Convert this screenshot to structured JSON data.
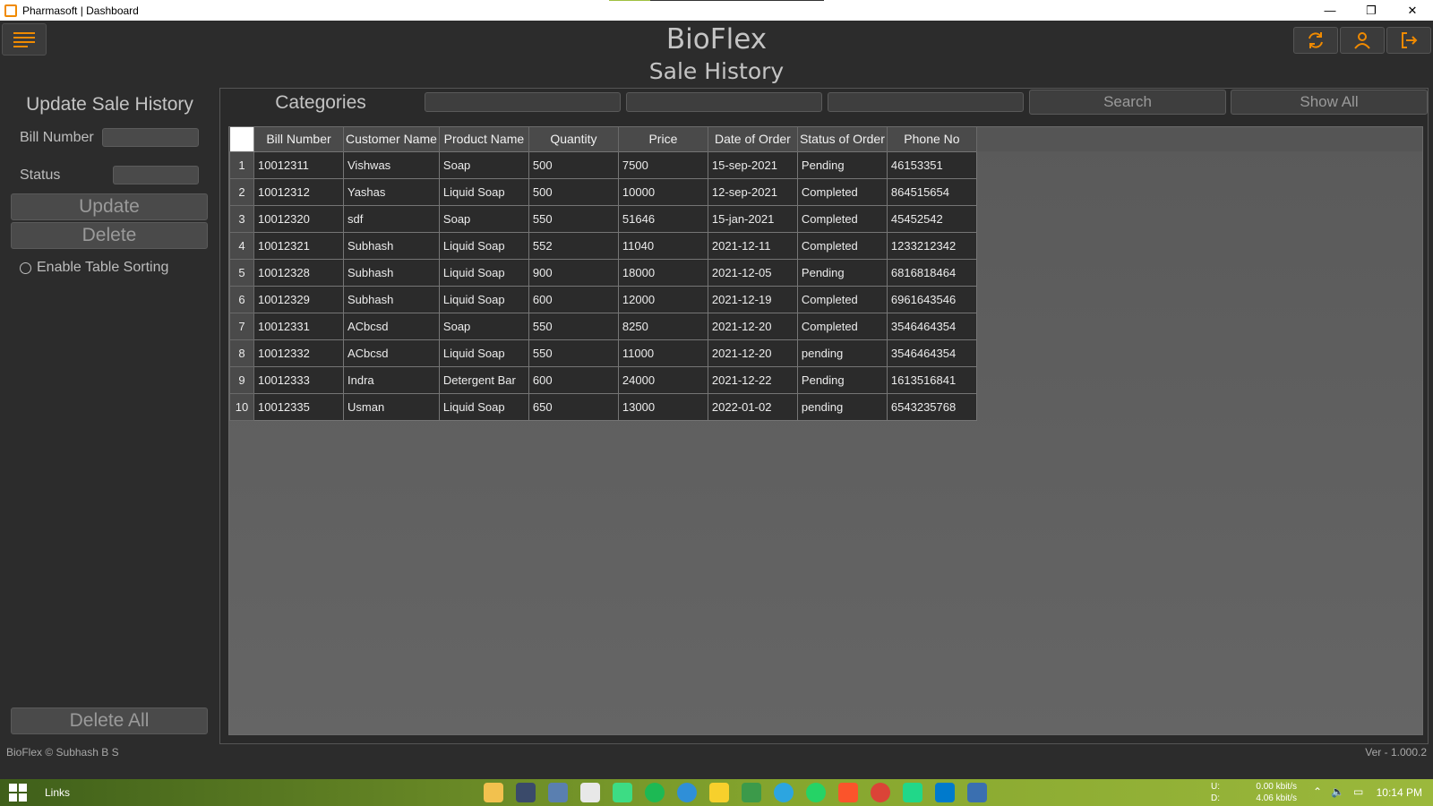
{
  "window": {
    "title": "Pharmasoft | Dashboard",
    "minimize": "—",
    "maximize": "❐",
    "close": "✕"
  },
  "header": {
    "app_title": "BioFlex",
    "subtitle": "Sale History"
  },
  "left_panel": {
    "title": "Update Sale History",
    "bill_number_label": "Bill Number",
    "status_label": "Status",
    "update_label": "Update",
    "delete_label": "Delete",
    "sorting_label": "Enable Table Sorting",
    "delete_all_label": "Delete All"
  },
  "filters": {
    "categories_label": "Categories",
    "search_label": "Search",
    "show_all_label": "Show All"
  },
  "table": {
    "columns": [
      "Bill Number",
      "Customer Name",
      "Product Name",
      "Quantity",
      "Price",
      "Date of Order",
      "Status of Order",
      "Phone No"
    ],
    "rows": [
      [
        "1",
        "10012311",
        "Vishwas",
        "Soap",
        "500",
        "7500",
        "15-sep-2021",
        "Pending",
        "46153351"
      ],
      [
        "2",
        "10012312",
        "Yashas",
        "Liquid Soap",
        "500",
        "10000",
        "12-sep-2021",
        "Completed",
        "864515654"
      ],
      [
        "3",
        "10012320",
        "sdf",
        "Soap",
        "550",
        "51646",
        "15-jan-2021",
        "Completed",
        "45452542"
      ],
      [
        "4",
        "10012321",
        "Subhash",
        "Liquid Soap",
        "552",
        "11040",
        "2021-12-11",
        "Completed",
        "1233212342"
      ],
      [
        "5",
        "10012328",
        "Subhash",
        "Liquid Soap",
        "900",
        "18000",
        "2021-12-05",
        "Pending",
        "6816818464"
      ],
      [
        "6",
        "10012329",
        "Subhash",
        "Liquid Soap",
        "600",
        "12000",
        "2021-12-19",
        "Completed",
        "6961643546"
      ],
      [
        "7",
        "10012331",
        "ACbcsd",
        "Soap",
        "550",
        "8250",
        "2021-12-20",
        "Completed",
        "3546464354"
      ],
      [
        "8",
        "10012332",
        "ACbcsd",
        "Liquid Soap",
        "550",
        "11000",
        "2021-12-20",
        "pending",
        "3546464354"
      ],
      [
        "9",
        "10012333",
        "Indra",
        "Detergent Bar",
        "600",
        "24000",
        "2021-12-22",
        "Pending",
        "1613516841"
      ],
      [
        "10",
        "10012335",
        "Usman",
        "Liquid Soap",
        "650",
        "13000",
        "2022-01-02",
        "pending",
        "6543235768"
      ]
    ]
  },
  "footer": {
    "copyright": "BioFlex © Subhash B S",
    "version": "Ver - 1.000.2"
  },
  "taskbar": {
    "links_label": "Links",
    "net_up_label": "U:",
    "net_down_label": "D:",
    "up_rate": "0.00 kbit/s",
    "down_rate": "4.06 kbit/s",
    "clock": "10:14 PM"
  },
  "colors": {
    "accent": "#f08a00",
    "background": "#2c2c2c",
    "panel": "#3b3b3b"
  }
}
